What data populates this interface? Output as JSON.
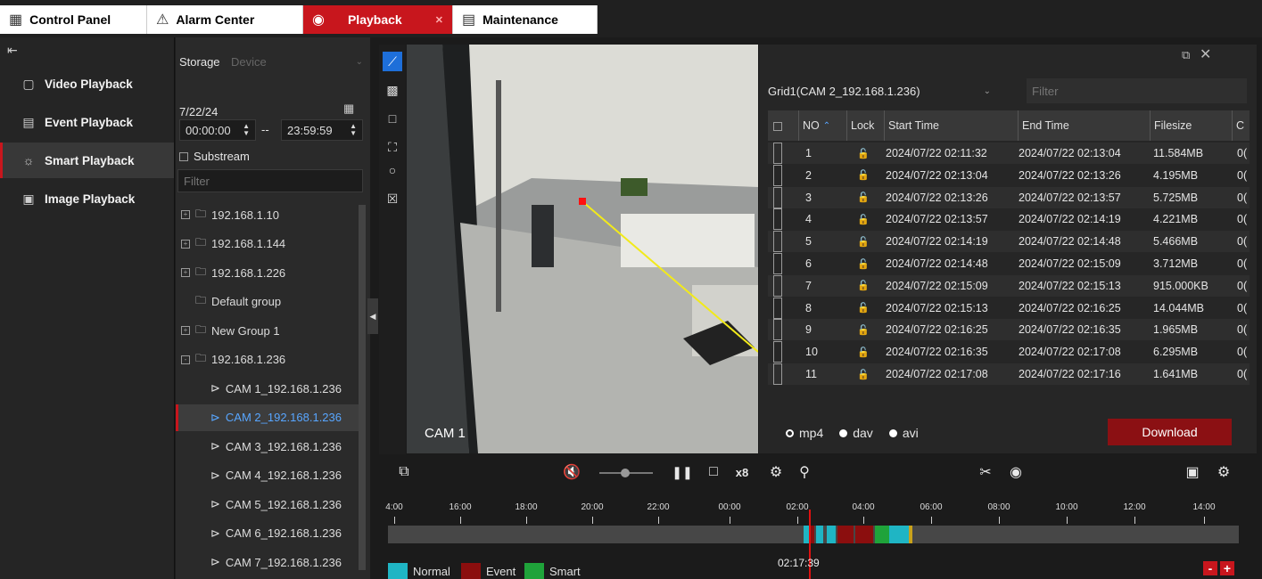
{
  "tabs": [
    {
      "label": "Control Panel",
      "icon": "grid-icon"
    },
    {
      "label": "Alarm Center",
      "icon": "bell-icon"
    },
    {
      "label": "Playback",
      "icon": "play-circle-icon"
    },
    {
      "label": "Maintenance",
      "icon": "report-icon"
    }
  ],
  "nav": {
    "items": [
      {
        "label": "Video Playback",
        "icon": "video-icon"
      },
      {
        "label": "Event Playback",
        "icon": "list-icon"
      },
      {
        "label": "Smart Playback",
        "icon": "bulb-icon"
      },
      {
        "label": "Image Playback",
        "icon": "image-icon"
      }
    ],
    "selected": "Smart Playback"
  },
  "device_panel": {
    "storage_label": "Storage",
    "storage_value": "Device",
    "date": "7/22/24",
    "start_time": "00:00:00",
    "time_sep": "--",
    "end_time": "23:59:59",
    "substream_label": "Substream",
    "filter_placeholder": "Filter",
    "tree": [
      {
        "label": "192.168.1.10",
        "expander": "+"
      },
      {
        "label": "192.168.1.144",
        "expander": "+"
      },
      {
        "label": "192.168.1.226",
        "expander": "+"
      },
      {
        "label": "Default group",
        "expander": ""
      },
      {
        "label": "New Group 1",
        "expander": "+"
      },
      {
        "label": "192.168.1.236",
        "expander": "-"
      }
    ],
    "cameras": [
      "CAM 1_192.168.1.236",
      "CAM 2_192.168.1.236",
      "CAM 3_192.168.1.236",
      "CAM 4_192.168.1.236",
      "CAM 5_192.168.1.236",
      "CAM 6_192.168.1.236",
      "CAM 7_192.168.1.236"
    ],
    "selected_camera": "CAM 2_192.168.1.236"
  },
  "video": {
    "label": "CAM 1"
  },
  "record_panel": {
    "grid_select": "Grid1(CAM 2_192.168.1.236)",
    "filter_placeholder": "Filter",
    "columns": [
      "NO",
      "Lock",
      "Start Time",
      "End Time",
      "Filesize",
      "C"
    ],
    "rows": [
      {
        "no": "1",
        "start": "2024/07/22 02:11:32",
        "end": "2024/07/22 02:13:04",
        "size": "11.584MB",
        "c": "0("
      },
      {
        "no": "2",
        "start": "2024/07/22 02:13:04",
        "end": "2024/07/22 02:13:26",
        "size": "4.195MB",
        "c": "0("
      },
      {
        "no": "3",
        "start": "2024/07/22 02:13:26",
        "end": "2024/07/22 02:13:57",
        "size": "5.725MB",
        "c": "0("
      },
      {
        "no": "4",
        "start": "2024/07/22 02:13:57",
        "end": "2024/07/22 02:14:19",
        "size": "4.221MB",
        "c": "0("
      },
      {
        "no": "5",
        "start": "2024/07/22 02:14:19",
        "end": "2024/07/22 02:14:48",
        "size": "5.466MB",
        "c": "0("
      },
      {
        "no": "6",
        "start": "2024/07/22 02:14:48",
        "end": "2024/07/22 02:15:09",
        "size": "3.712MB",
        "c": "0("
      },
      {
        "no": "7",
        "start": "2024/07/22 02:15:09",
        "end": "2024/07/22 02:15:13",
        "size": "915.000KB",
        "c": "0("
      },
      {
        "no": "8",
        "start": "2024/07/22 02:15:13",
        "end": "2024/07/22 02:16:25",
        "size": "14.044MB",
        "c": "0("
      },
      {
        "no": "9",
        "start": "2024/07/22 02:16:25",
        "end": "2024/07/22 02:16:35",
        "size": "1.965MB",
        "c": "0("
      },
      {
        "no": "10",
        "start": "2024/07/22 02:16:35",
        "end": "2024/07/22 02:17:08",
        "size": "6.295MB",
        "c": "0("
      },
      {
        "no": "11",
        "start": "2024/07/22 02:17:08",
        "end": "2024/07/22 02:17:16",
        "size": "1.641MB",
        "c": "0("
      }
    ],
    "formats": [
      {
        "label": "mp4",
        "selected": false
      },
      {
        "label": "dav",
        "selected": true
      },
      {
        "label": "avi",
        "selected": true
      }
    ],
    "download_label": "Download"
  },
  "controls": {
    "speed": "x8",
    "current_time": "02:17:39"
  },
  "timeline": {
    "ticks": [
      "4:00",
      "16:00",
      "18:00",
      "20:00",
      "22:00",
      "00:00",
      "02:00",
      "04:00",
      "06:00",
      "08:00",
      "10:00",
      "12:00",
      "14:00"
    ]
  },
  "legend": [
    {
      "label": "Normal",
      "color": "#1fb5c4"
    },
    {
      "label": "Event",
      "color": "#8b0e0e"
    },
    {
      "label": "Smart",
      "color": "#1fa33a"
    }
  ],
  "colors": {
    "accent": "#c8161d",
    "selection": "#1e6fd9"
  }
}
